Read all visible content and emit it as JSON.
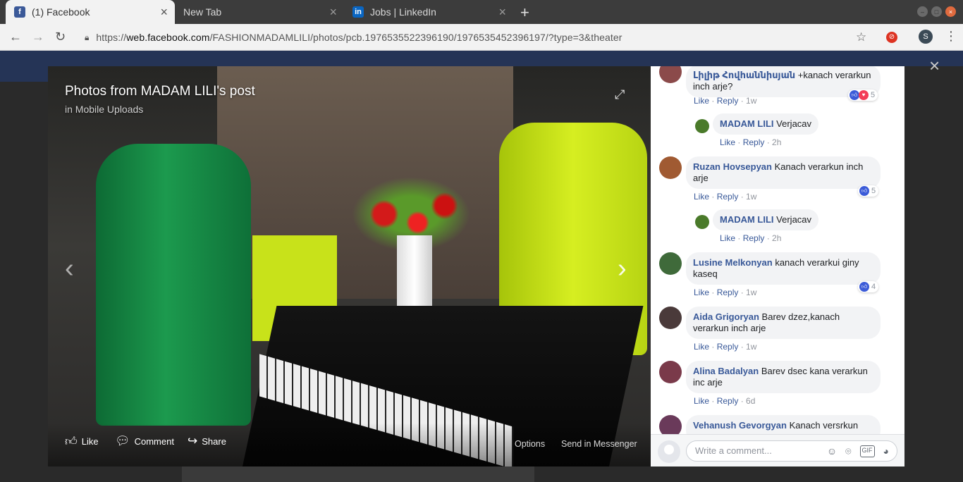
{
  "browser": {
    "tabs": [
      {
        "title": "(1) Facebook",
        "icon": "facebook-icon",
        "active": true
      },
      {
        "title": "New Tab",
        "icon": "",
        "active": false
      },
      {
        "title": "Jobs | LinkedIn",
        "icon": "linkedin-icon",
        "active": false
      }
    ],
    "url_host": "web.facebook.com",
    "url_scheme": "https://",
    "url_path": "/FASHIONMADAMLILI/photos/pcb.1976535522396190/1976535452396197/?type=3&theater",
    "profile_initial": "S",
    "new_tab_symbol": "+",
    "close_symbol": "×"
  },
  "photo": {
    "title": "Photos from MADAM LILI's post",
    "subtitle_prefix": "in",
    "subtitle_link": "Mobile Uploads",
    "actions": {
      "like": "Like",
      "comment": "Comment",
      "share": "Share",
      "options": "Options",
      "send_messenger": "Send in Messenger"
    }
  },
  "comments": [
    {
      "author": "Լիլիթ Հովհաննիսյան",
      "text": "+kanach verarkun inch arje?",
      "like": "Like",
      "reply": "Reply",
      "time": "1w",
      "reactions": "5",
      "has_love": true
    },
    {
      "author": "MADAM LILI",
      "text": "Verjacav",
      "like": "Like",
      "reply": "Reply",
      "time": "2h",
      "reply_level": true
    },
    {
      "author": "Ruzan Hovsepyan",
      "text": "Kanach verarkun inch arje",
      "like": "Like",
      "reply": "Reply",
      "time": "1w",
      "reactions": "5"
    },
    {
      "author": "MADAM LILI",
      "text": "Verjacav",
      "like": "Like",
      "reply": "Reply",
      "time": "2h",
      "reply_level": true
    },
    {
      "author": "Lusine Melkonyan",
      "text": "kanach verarkui giny kaseq",
      "like": "Like",
      "reply": "Reply",
      "time": "1w",
      "reactions": "4"
    },
    {
      "author": "Aida Grigoryan",
      "text": "Barev dzez,kanach verarkun inch arje",
      "like": "Like",
      "reply": "Reply",
      "time": "1w"
    },
    {
      "author": "Alina Badalyan",
      "text": "Barev dsec kana verarkun inc arje",
      "like": "Like",
      "reply": "Reply",
      "time": "6d"
    },
    {
      "author": "Vehanush Gevorgyan",
      "text": "Kanach versrkun",
      "like": "",
      "reply": "",
      "time": ""
    }
  ],
  "write_comment": {
    "placeholder": "Write a comment..."
  },
  "colors": {
    "facebook_blue": "#385898",
    "fb_nav": "#253456",
    "like_blue": "#3b5bd8",
    "love_red": "#f33e58"
  }
}
